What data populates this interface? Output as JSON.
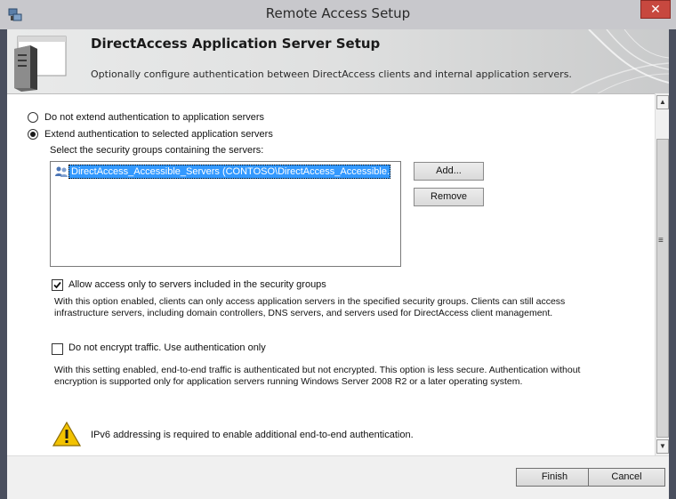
{
  "window": {
    "title": "Remote Access Setup",
    "close_label": "✕"
  },
  "banner": {
    "title": "DirectAccess Application Server Setup",
    "subtitle": "Optionally configure authentication between DirectAccess clients and internal application servers."
  },
  "options": {
    "no_extend_label": "Do not extend authentication to application servers",
    "no_extend_checked": false,
    "extend_label": "Extend authentication to selected application servers",
    "extend_checked": true
  },
  "security_groups": {
    "prompt": "Select the security groups containing the servers:",
    "items": [
      {
        "label": "DirectAccess_Accessible_Servers (CONTOSO\\DirectAccess_Accessible...",
        "selected": true
      }
    ],
    "add_label": "Add...",
    "remove_label": "Remove"
  },
  "allow_access": {
    "label": "Allow access only to servers included in the security groups",
    "checked": true,
    "description_line1": "With this option enabled, clients can only access application servers in the specified security groups. Clients can still access",
    "description_line2": "infrastructure servers, including domain controllers, DNS servers, and servers used for DirectAccess client management."
  },
  "no_encrypt": {
    "label": "Do not encrypt traffic. Use authentication only",
    "checked": false,
    "description_line1": "With this setting enabled, end-to-end traffic is authenticated but not encrypted. This option is less secure. Authentication without",
    "description_line2": "encryption is supported only for application servers running Windows Server 2008 R2 or a later operating system."
  },
  "warning": {
    "icon": "warning-icon",
    "text": "IPv6 addressing is required to enable additional end-to-end authentication."
  },
  "footer": {
    "finish_label": "Finish",
    "cancel_label": "Cancel"
  },
  "colors": {
    "selection": "#3399ff",
    "close_button": "#c7483f",
    "warning_yellow": "#f2c200"
  }
}
